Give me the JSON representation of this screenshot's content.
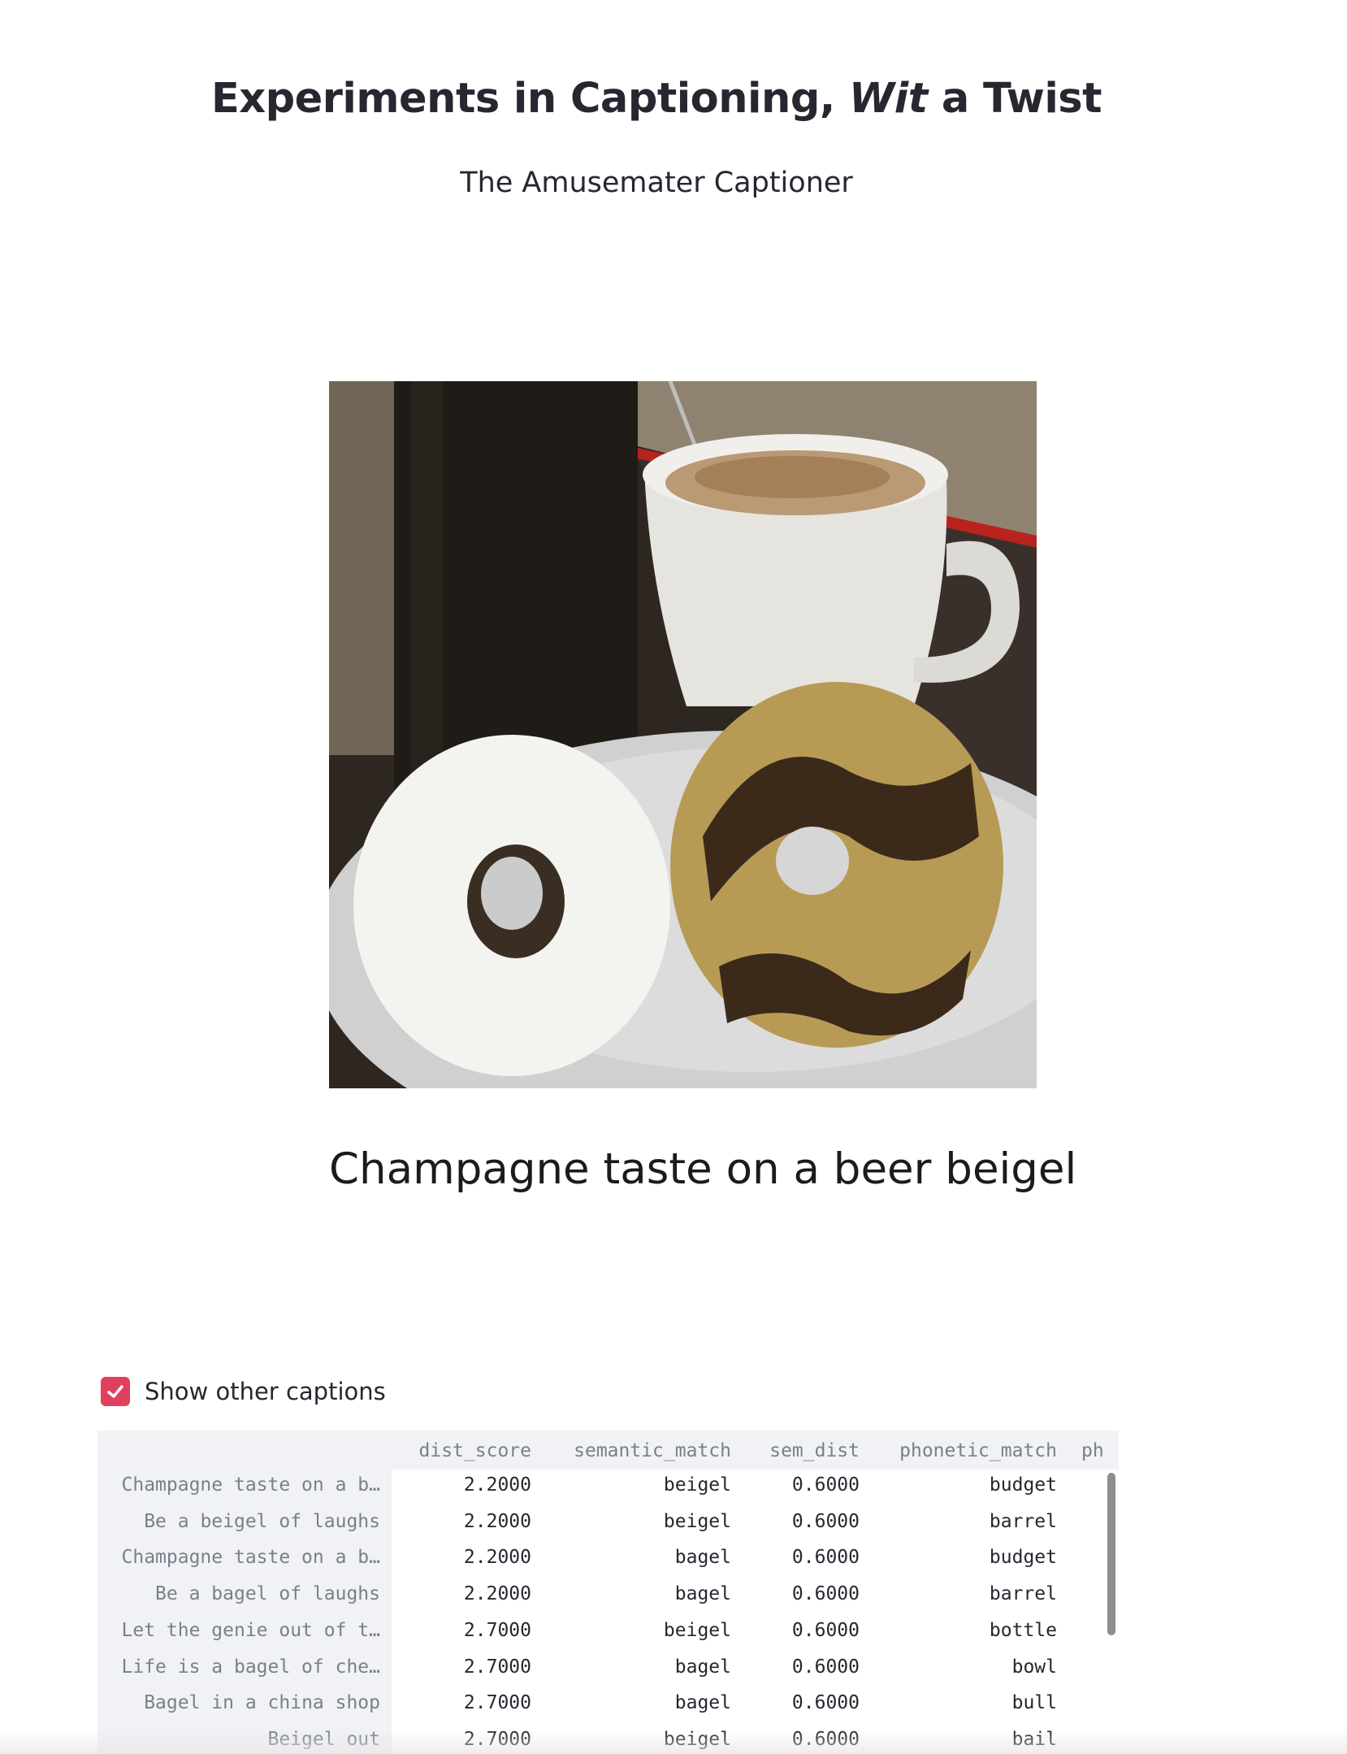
{
  "header": {
    "title_part1": "Experiments in Captioning, ",
    "title_italic": "Wit",
    "title_part2": " a Twist",
    "subtitle": "The Amusemater Captioner"
  },
  "photo": {
    "description_icon": "bagel-photo"
  },
  "caption": "Champagne taste on a beer beigel",
  "show_other_captions": {
    "label": "Show other captions",
    "checked": true,
    "color": "#e0405e"
  },
  "table": {
    "columns": [
      "dist_score",
      "semantic_match",
      "sem_dist",
      "phonetic_match",
      "ph"
    ],
    "rows": [
      {
        "index": "Champagne taste on a b…",
        "dist_score": "2.2000",
        "semantic_match": "beigel",
        "sem_dist": "0.6000",
        "phonetic_match": "budget"
      },
      {
        "index": "Be a beigel of laughs",
        "dist_score": "2.2000",
        "semantic_match": "beigel",
        "sem_dist": "0.6000",
        "phonetic_match": "barrel"
      },
      {
        "index": "Champagne taste on a b…",
        "dist_score": "2.2000",
        "semantic_match": "bagel",
        "sem_dist": "0.6000",
        "phonetic_match": "budget"
      },
      {
        "index": "Be a bagel of laughs",
        "dist_score": "2.2000",
        "semantic_match": "bagel",
        "sem_dist": "0.6000",
        "phonetic_match": "barrel"
      },
      {
        "index": "Let the genie out of t…",
        "dist_score": "2.7000",
        "semantic_match": "beigel",
        "sem_dist": "0.6000",
        "phonetic_match": "bottle"
      },
      {
        "index": "Life is a bagel of che…",
        "dist_score": "2.7000",
        "semantic_match": "bagel",
        "sem_dist": "0.6000",
        "phonetic_match": "bowl"
      },
      {
        "index": "Bagel in a china shop",
        "dist_score": "2.7000",
        "semantic_match": "bagel",
        "sem_dist": "0.6000",
        "phonetic_match": "bull"
      },
      {
        "index": "Beigel out",
        "dist_score": "2.7000",
        "semantic_match": "beigel",
        "sem_dist": "0.6000",
        "phonetic_match": "bail"
      }
    ]
  }
}
